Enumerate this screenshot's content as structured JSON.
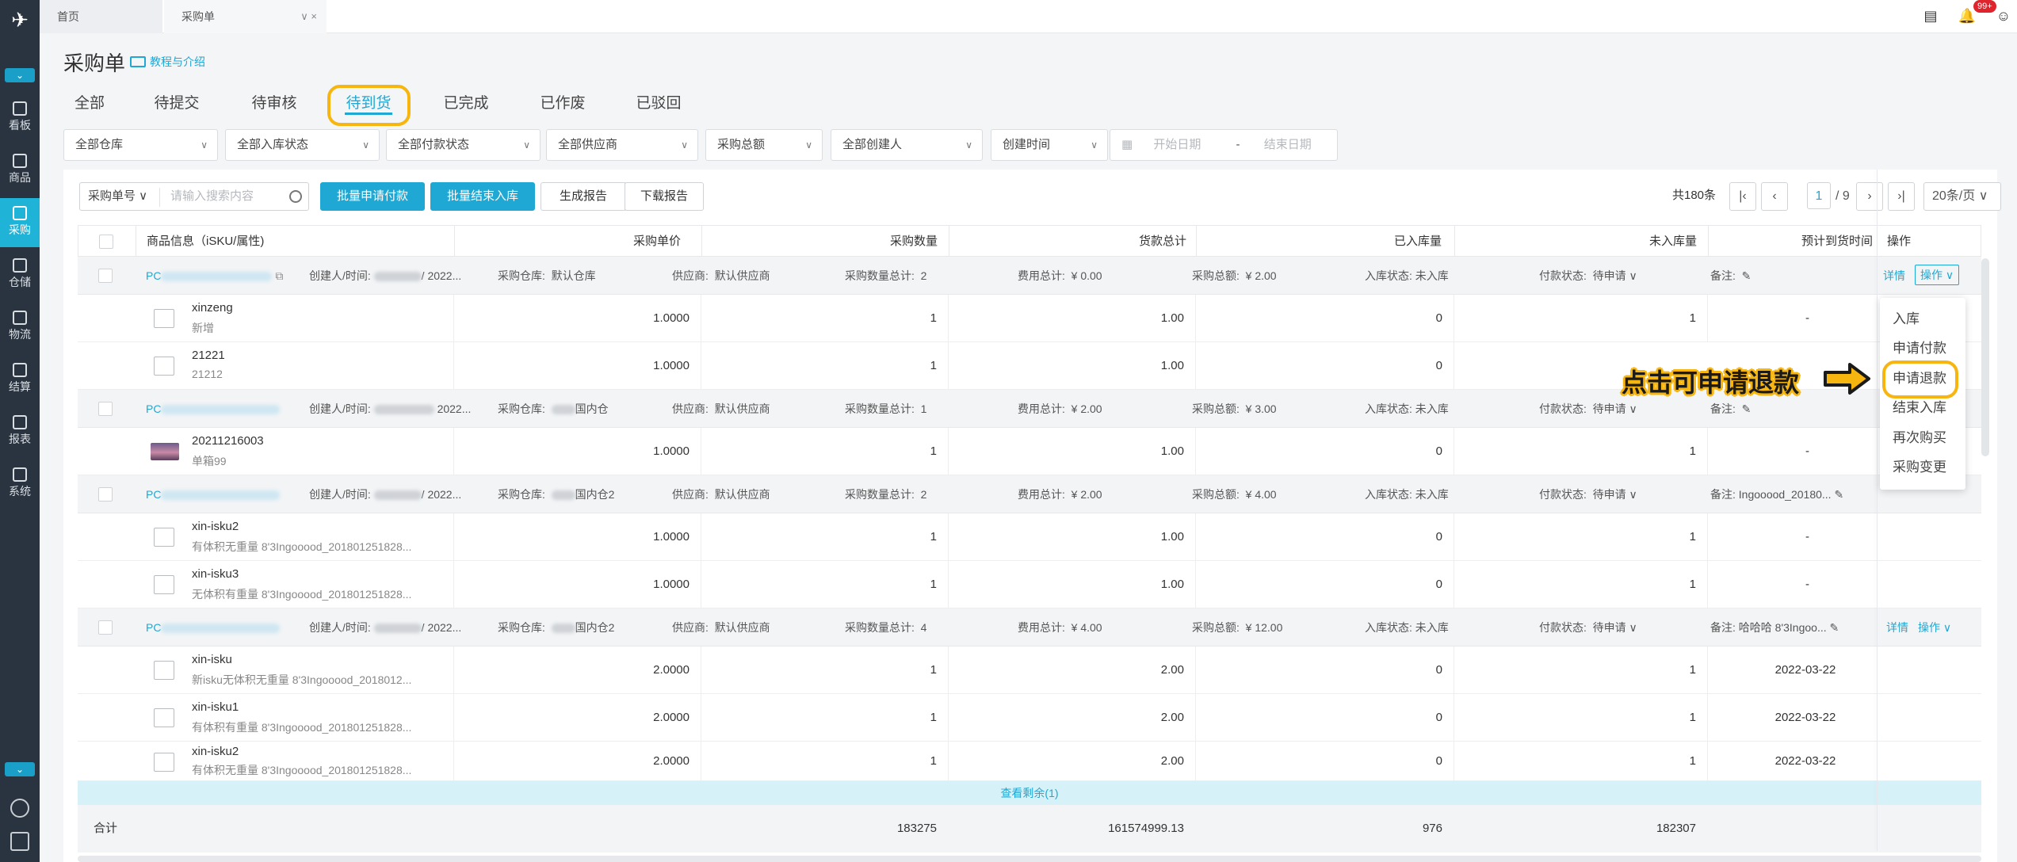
{
  "tabs": {
    "home": "首页",
    "purchase": "采购单",
    "purchase_ctl": "∨ ×"
  },
  "notifications": {
    "badge": "99+"
  },
  "sidebar": {
    "items": [
      {
        "label": "看板"
      },
      {
        "label": "商品"
      },
      {
        "label": "采购"
      },
      {
        "label": "仓储"
      },
      {
        "label": "物流"
      },
      {
        "label": "结算"
      },
      {
        "label": "报表"
      },
      {
        "label": "系统"
      }
    ]
  },
  "page": {
    "title": "采购单",
    "tutorial": "教程与介绍"
  },
  "status_tabs": [
    "全部",
    "待提交",
    "待审核",
    "待到货",
    "已完成",
    "已作废",
    "已驳回"
  ],
  "filters": {
    "warehouse": "全部仓库",
    "inbound_status": "全部入库状态",
    "payment_status": "全部付款状态",
    "supplier": "全部供应商",
    "total_amount": "采购总额",
    "creator": "全部创建人",
    "created_time": "创建时间",
    "start_date": "开始日期",
    "date_sep": "-",
    "end_date": "结束日期"
  },
  "toolbar": {
    "search_select": "采购单号",
    "search_placeholder": "请输入搜索内容",
    "batch_pay": "批量申请付款",
    "batch_finish": "批量结束入库",
    "gen_report": "生成报告",
    "download_report": "下载报告"
  },
  "pagination": {
    "total": "共180条",
    "page": "1",
    "pages": "/ 9",
    "per_page": "20条/页"
  },
  "table": {
    "headers": {
      "product": "商品信息（iSKU/属性)",
      "unit_price": "采购单价",
      "qty": "采购数量",
      "goods_total": "货款总计",
      "received": "已入库量",
      "pending": "未入库量",
      "eta": "预计到货时间",
      "ops": "操作"
    },
    "group_labels": {
      "creator": "创建人/时间:",
      "warehouse": "采购仓库:",
      "supplier": "供应商:",
      "qty_total": "采购数量总计:",
      "fee_total": "费用总计:",
      "purchase_total": "采购总额:",
      "inbound_status": "入库状态:",
      "pay_status": "付款状态:",
      "remark": "备注:",
      "detail": "详情",
      "op": "操作"
    },
    "groups": [
      {
        "po_prefix": "PC",
        "time": "/ 2022...",
        "warehouse": "默认仓库",
        "supplier": "默认供应商",
        "qty_total": "2",
        "fee_total": "¥ 0.00",
        "purchase_total": "¥ 2.00",
        "inbound": "未入库",
        "pay": "待申请",
        "remark": "",
        "items": [
          {
            "name": "xinzeng",
            "attr": "新增",
            "price": "1.0000",
            "qty": "1",
            "total": "1.00",
            "received": "0",
            "pending": "1",
            "eta": "-"
          },
          {
            "name": "21221",
            "attr": "21212",
            "price": "1.0000",
            "qty": "1",
            "total": "1.00",
            "received": "0",
            "pending": "",
            "eta": ""
          }
        ]
      },
      {
        "po_prefix": "PC",
        "time": "2022...",
        "warehouse": "国内仓",
        "supplier": "默认供应商",
        "qty_total": "1",
        "fee_total": "¥ 2.00",
        "purchase_total": "¥ 3.00",
        "inbound": "未入库",
        "pay": "待申请",
        "remark": "",
        "items": [
          {
            "name": "20211216003",
            "attr": "单箱99",
            "price": "1.0000",
            "qty": "1",
            "total": "1.00",
            "received": "0",
            "pending": "1",
            "eta": "-"
          }
        ]
      },
      {
        "po_prefix": "PC",
        "time": "/ 2022...",
        "warehouse": "国内仓2",
        "supplier": "默认供应商",
        "qty_total": "2",
        "fee_total": "¥ 2.00",
        "purchase_total": "¥ 4.00",
        "inbound": "未入库",
        "pay": "待申请",
        "remark": "Ingooood_20180...",
        "items": [
          {
            "name": "xin-isku2",
            "attr": "有体积无重量 8'3Ingooood_201801251828...",
            "price": "1.0000",
            "qty": "1",
            "total": "1.00",
            "received": "0",
            "pending": "1",
            "eta": "-"
          },
          {
            "name": "xin-isku3",
            "attr": "无体积有重量 8'3Ingooood_201801251828...",
            "price": "1.0000",
            "qty": "1",
            "total": "1.00",
            "received": "0",
            "pending": "1",
            "eta": "-"
          }
        ]
      },
      {
        "po_prefix": "PC",
        "time": "/ 2022...",
        "warehouse": "国内仓2",
        "supplier": "默认供应商",
        "qty_total": "4",
        "fee_total": "¥ 4.00",
        "purchase_total": "¥ 12.00",
        "inbound": "未入库",
        "pay": "待申请",
        "remark": "哈哈哈 8'3Ingoo...",
        "items": [
          {
            "name": "xin-isku",
            "attr": "新isku无体积无重量 8'3Ingooood_2018012...",
            "price": "2.0000",
            "qty": "1",
            "total": "2.00",
            "received": "0",
            "pending": "1",
            "eta": "2022-03-22"
          },
          {
            "name": "xin-isku1",
            "attr": "有体积有重量 8'3Ingooood_201801251828...",
            "price": "2.0000",
            "qty": "1",
            "total": "2.00",
            "received": "0",
            "pending": "1",
            "eta": "2022-03-22"
          },
          {
            "name": "xin-isku2",
            "attr": "有体积无重量 8'3Ingooood_201801251828...",
            "price": "2.0000",
            "qty": "1",
            "total": "2.00",
            "received": "0",
            "pending": "1",
            "eta": "2022-03-22"
          }
        ]
      }
    ],
    "view_more": "查看剩余(1)",
    "summary": {
      "label": "合计",
      "qty": "183275",
      "goods_total": "161574999.13",
      "received": "976",
      "pending": "182307"
    }
  },
  "dropdown": {
    "items": [
      "入库",
      "申请付款",
      "申请退款",
      "结束入库",
      "再次购买",
      "采购变更"
    ]
  },
  "callout": "点击可申请退款",
  "colors": {
    "accent": "#1fa8d3",
    "sidebar": "#2a3440",
    "highlight": "#f7b510"
  }
}
